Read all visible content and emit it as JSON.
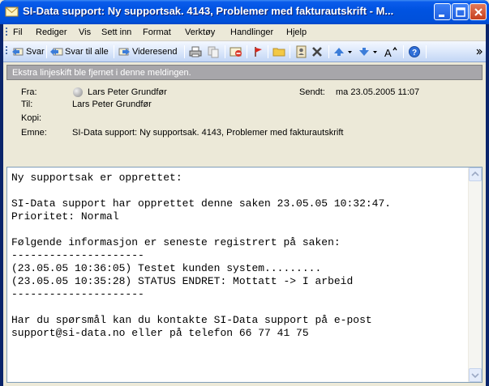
{
  "window": {
    "title": "SI-Data support: Ny supportsak. 4143, Problemer med fakturautskrift - M..."
  },
  "menu": {
    "items": [
      "Fil",
      "Rediger",
      "Vis",
      "Sett inn",
      "Format",
      "Verktøy",
      "Handlinger",
      "Hjelp"
    ]
  },
  "toolbar": {
    "reply": "Svar",
    "reply_all": "Svar til alle",
    "forward": "Videresend"
  },
  "infobar": {
    "text": "Ekstra linjeskift ble fjernet i denne meldingen."
  },
  "header": {
    "from_label": "Fra:",
    "from_value": "Lars Peter Grundfør",
    "sent_label": "Sendt:",
    "sent_value": "ma 23.05.2005 11:07",
    "to_label": "Til:",
    "to_value": "Lars Peter Grundfør",
    "cc_label": "Kopi:",
    "cc_value": "",
    "subject_label": "Emne:",
    "subject_value": "SI-Data support: Ny supportsak. 4143, Problemer med fakturautskrift"
  },
  "body": {
    "lines": [
      "Ny supportsak er opprettet:",
      "",
      "SI-Data support har opprettet denne saken 23.05.05 10:32:47.",
      "Prioritet: Normal",
      "",
      "Følgende informasjon er seneste registrert på saken:",
      "---------------------",
      "(23.05.05 10:36:05) Testet kunden system.........",
      "(23.05.05 10:35:28) STATUS ENDRET: Mottatt -> I arbeid",
      "---------------------",
      "",
      "Har du spørsmål kan du kontakte SI-Data support på e-post",
      "support@si-data.no eller på telefon 66 77 41 75"
    ]
  },
  "colors": {
    "titlebar": "#0053E1",
    "window_bg": "#ECE9D8",
    "infobar_bg": "#A7A6AA"
  }
}
